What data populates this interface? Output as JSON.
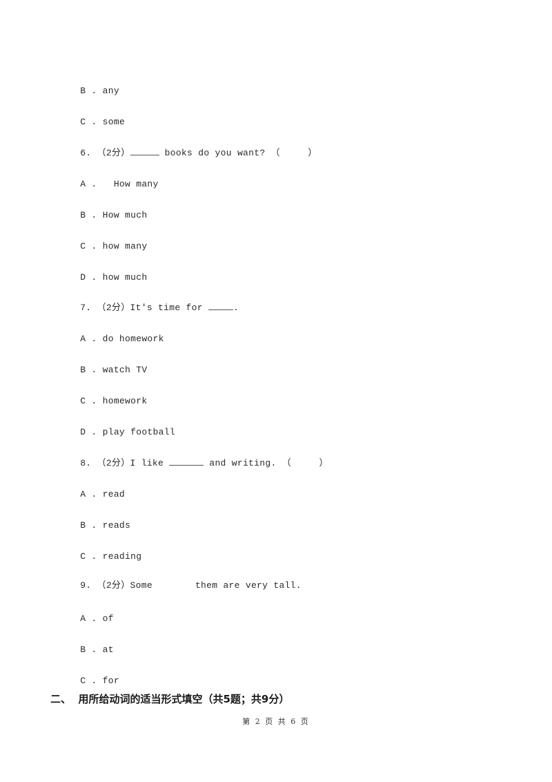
{
  "document": {
    "type": "exam-page",
    "leading_options": [
      {
        "letter": "B",
        "text": "any"
      },
      {
        "letter": "C",
        "text": "some"
      }
    ],
    "questions": [
      {
        "number": "6.",
        "points": "（2分）",
        "before_blank": "",
        "after_blank": " books do you want? （     ）",
        "options": [
          {
            "letter": "A",
            "text": "  How many"
          },
          {
            "letter": "B",
            "text": "How much"
          },
          {
            "letter": "C",
            "text": "how many"
          },
          {
            "letter": "D",
            "text": "how much"
          }
        ]
      },
      {
        "number": "7.",
        "points": "（2分）",
        "before_blank": "It's time for ",
        "after_blank": ".",
        "options": [
          {
            "letter": "A",
            "text": "do homework"
          },
          {
            "letter": "B",
            "text": "watch TV"
          },
          {
            "letter": "C",
            "text": "homework"
          },
          {
            "letter": "D",
            "text": "play football"
          }
        ]
      },
      {
        "number": "8.",
        "points": "（2分）",
        "before_blank": "I like ",
        "after_blank": " and writing. （     ）",
        "options": [
          {
            "letter": "A",
            "text": "read"
          },
          {
            "letter": "B",
            "text": "reads"
          },
          {
            "letter": "C",
            "text": "reading"
          }
        ]
      },
      {
        "number": "9.",
        "points": "（2分）",
        "before_blank": "Some",
        "after_blank": "them are very tall.",
        "options": [
          {
            "letter": "A",
            "text": "of"
          },
          {
            "letter": "B",
            "text": "at"
          },
          {
            "letter": "C",
            "text": "for"
          }
        ]
      }
    ],
    "option_separator": " . ",
    "section_heading": "二、  用所给动词的适当形式填空（共5题；共9分）",
    "footer": "第 2 页 共 6 页"
  }
}
